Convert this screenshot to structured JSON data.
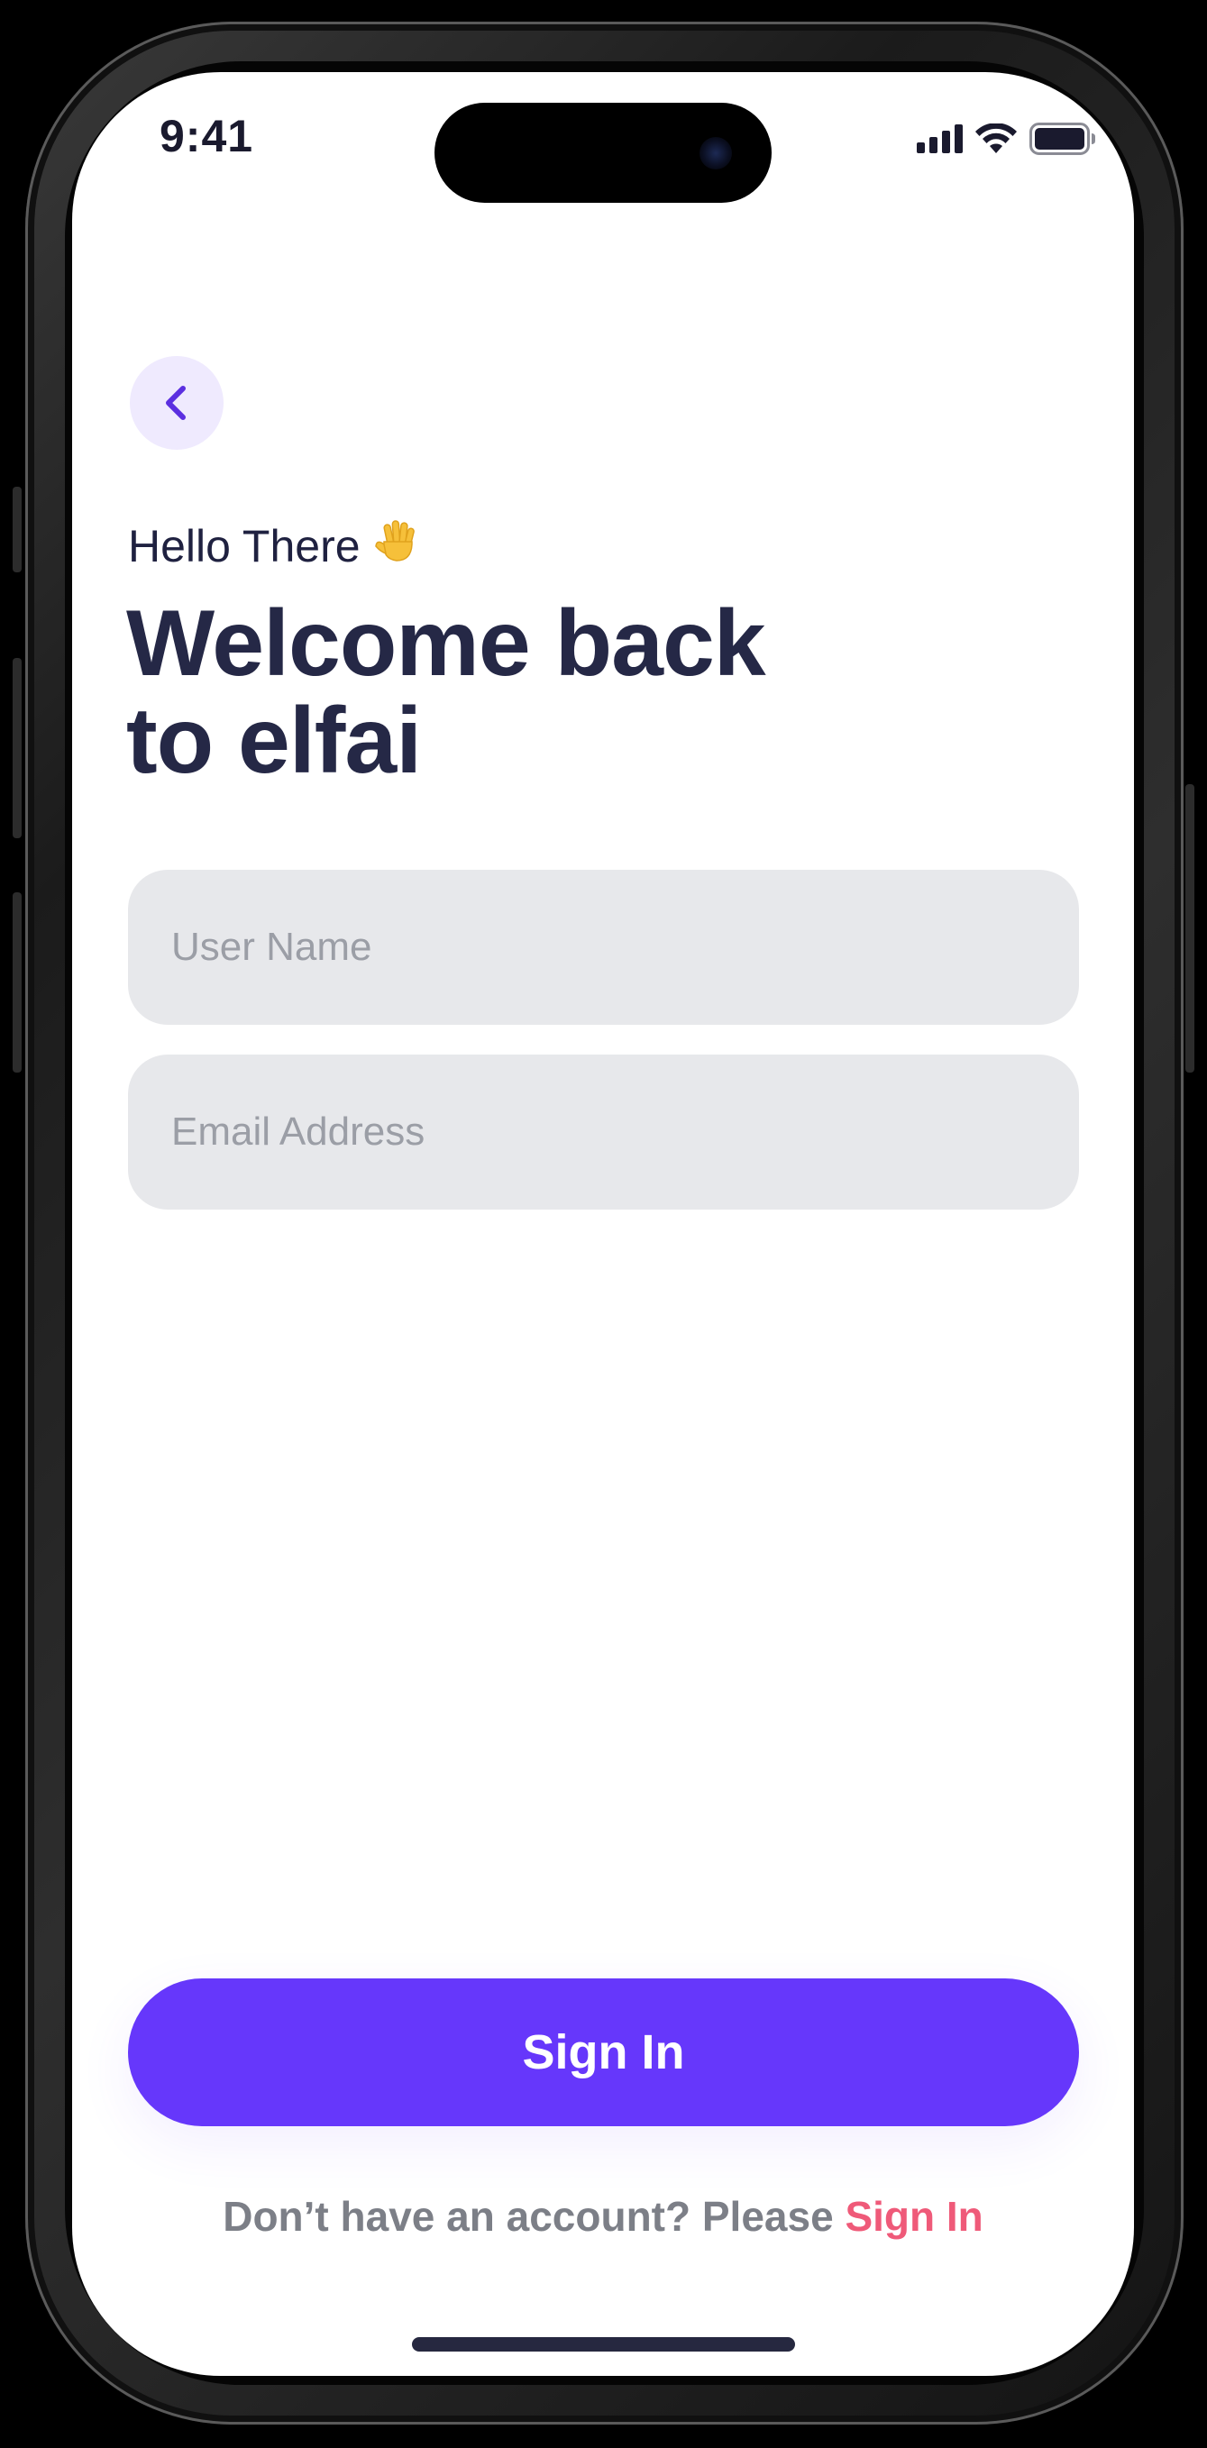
{
  "status_bar": {
    "time": "9:41",
    "signal_icon": "cellular-signal-icon",
    "wifi_icon": "wifi-icon",
    "battery_icon": "battery-icon"
  },
  "nav": {
    "back_icon": "chevron-left-icon"
  },
  "header": {
    "greeting": "Hello There",
    "greeting_emoji": "waving-hand-icon",
    "title_line1": "Welcome back",
    "title_line2": "to elfai"
  },
  "form": {
    "username_placeholder": "User Name",
    "username_value": "",
    "email_placeholder": "Email Address",
    "email_value": ""
  },
  "actions": {
    "primary_label": "Sign In",
    "footer_prompt": "Don’t have an account? Please",
    "footer_link": "Sign In"
  },
  "colors": {
    "primary": "#6637fb",
    "accent_link": "#ef5a79",
    "back_button_bg": "#efeafe",
    "input_bg": "#e7e8eb",
    "heading_text": "#252846"
  }
}
